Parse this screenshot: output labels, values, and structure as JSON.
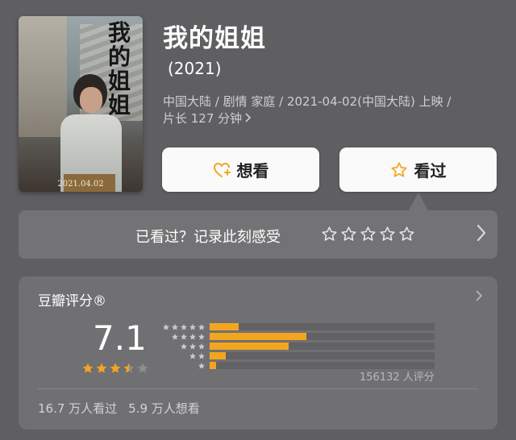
{
  "movie": {
    "poster_title_art": "我的姐姐",
    "poster_date": "2021.04.02",
    "title": "我的姐姐",
    "year": "(2021)",
    "meta_line1": "中国大陆 / 剧情 家庭 / 2021-04-02(中国大陆) 上映 /",
    "meta_line2": "片长 127 分钟"
  },
  "actions": {
    "want_label": "想看",
    "seen_label": "看过"
  },
  "rate_prompt": {
    "text": "已看过？记录此刻感受",
    "empty_stars": 5
  },
  "rating": {
    "title": "豆瓣评分®",
    "score": "7.1",
    "stars": 3.5,
    "distribution": [
      {
        "stars": 5,
        "fraction": 0.13
      },
      {
        "stars": 4,
        "fraction": 0.43
      },
      {
        "stars": 3,
        "fraction": 0.35
      },
      {
        "stars": 2,
        "fraction": 0.07
      },
      {
        "stars": 1,
        "fraction": 0.03
      }
    ],
    "count_label": "156132 人评分",
    "watched": "16.7 万人看过",
    "wish": "5.9 万人想看"
  },
  "colors": {
    "accent": "#f3a51f",
    "background": "#5f5f62",
    "card": "#707073"
  },
  "icons": {
    "want": "heart-plus-icon",
    "seen": "star-outline-icon",
    "chevron": "chevron-right-icon"
  }
}
